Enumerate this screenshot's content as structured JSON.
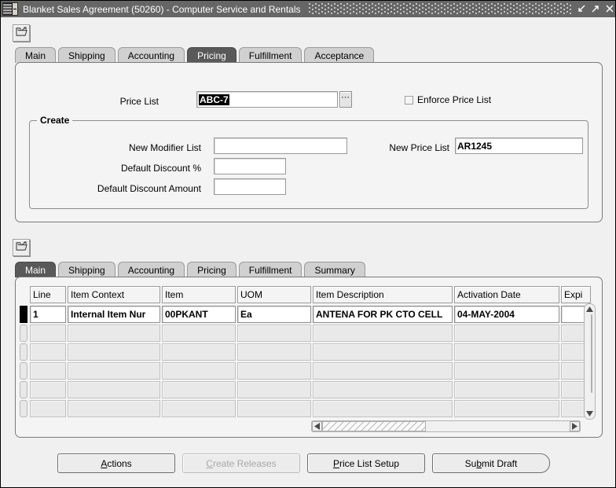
{
  "window": {
    "title": "Blanket Sales Agreement (50260) - Computer Service and Rentals",
    "menu_icon": "window-menu-icon",
    "controls": {
      "minimize": "minimize-icon",
      "maximize": "maximize-icon",
      "close": "close-icon"
    }
  },
  "header_panel": {
    "folder_icon": "open-folder-icon",
    "tabs": [
      {
        "label": "Main",
        "selected": false
      },
      {
        "label": "Shipping",
        "selected": false
      },
      {
        "label": "Accounting",
        "selected": false
      },
      {
        "label": "Pricing",
        "selected": true
      },
      {
        "label": "Fulfillment",
        "selected": false
      },
      {
        "label": "Acceptance",
        "selected": false
      }
    ],
    "price_list": {
      "label": "Price List",
      "value": "ABC-7",
      "selected": true,
      "lov_label": "..."
    },
    "enforce_price_list": {
      "label": "Enforce Price List",
      "checked": false
    },
    "create_group": {
      "title": "Create",
      "new_modifier_list": {
        "label": "New Modifier List",
        "value": ""
      },
      "default_discount_pct": {
        "label": "Default Discount %",
        "value": ""
      },
      "default_discount_amount": {
        "label": "Default Discount Amount",
        "value": ""
      },
      "new_price_list": {
        "label": "New Price List",
        "value": "AR1245"
      }
    }
  },
  "lines_panel": {
    "folder_icon": "open-folder-icon",
    "tabs": [
      {
        "label": "Main",
        "selected": true
      },
      {
        "label": "Shipping",
        "selected": false
      },
      {
        "label": "Accounting",
        "selected": false
      },
      {
        "label": "Pricing",
        "selected": false
      },
      {
        "label": "Fulfillment",
        "selected": false
      },
      {
        "label": "Summary",
        "selected": false
      }
    ],
    "grid": {
      "columns": [
        {
          "header": "Line",
          "width": 46
        },
        {
          "header": "Item Context",
          "width": 118
        },
        {
          "header": "Item",
          "width": 94
        },
        {
          "header": "UOM",
          "width": 94
        },
        {
          "header": "Item Description",
          "width": 178
        },
        {
          "header": "Activation Date",
          "width": 134
        },
        {
          "header": "Expi",
          "width": 38
        }
      ],
      "rows": [
        {
          "current": true,
          "cells": [
            "1",
            "Internal Item Nur",
            "00PKANT",
            "Ea",
            "ANTENA FOR PK CTO CELL",
            "04-MAY-2004",
            ""
          ]
        },
        {
          "current": false,
          "cells": [
            "",
            "",
            "",
            "",
            "",
            "",
            ""
          ]
        },
        {
          "current": false,
          "cells": [
            "",
            "",
            "",
            "",
            "",
            "",
            ""
          ]
        },
        {
          "current": false,
          "cells": [
            "",
            "",
            "",
            "",
            "",
            "",
            ""
          ]
        },
        {
          "current": false,
          "cells": [
            "",
            "",
            "",
            "",
            "",
            "",
            ""
          ]
        },
        {
          "current": false,
          "cells": [
            "",
            "",
            "",
            "",
            "",
            "",
            ""
          ]
        }
      ]
    },
    "scrollbars": {
      "vertical": {
        "up_icon": "scroll-up-arrow-icon",
        "down_icon": "scroll-down-arrow-icon"
      },
      "horizontal": {
        "left_icon": "scroll-left-arrow-icon",
        "right_icon": "scroll-right-arrow-icon"
      }
    }
  },
  "footer": {
    "buttons": [
      {
        "pre": "",
        "mn": "A",
        "post": "ctions",
        "disabled": false,
        "default": false
      },
      {
        "pre": "",
        "mn": "C",
        "post": "reate Releases",
        "disabled": true,
        "default": false
      },
      {
        "pre": "",
        "mn": "P",
        "post": "rice List Setup",
        "disabled": false,
        "default": false
      },
      {
        "pre": "Su",
        "mn": "b",
        "post": "mit Draft",
        "disabled": false,
        "default": true
      }
    ]
  },
  "colors": {
    "titlebar": "#666666",
    "selected_tab": "#595959",
    "tab": "#d0d0d0",
    "panel": "#f4f4f4",
    "field": "#ffffff",
    "disabled_cell": "#e9e9e9"
  }
}
